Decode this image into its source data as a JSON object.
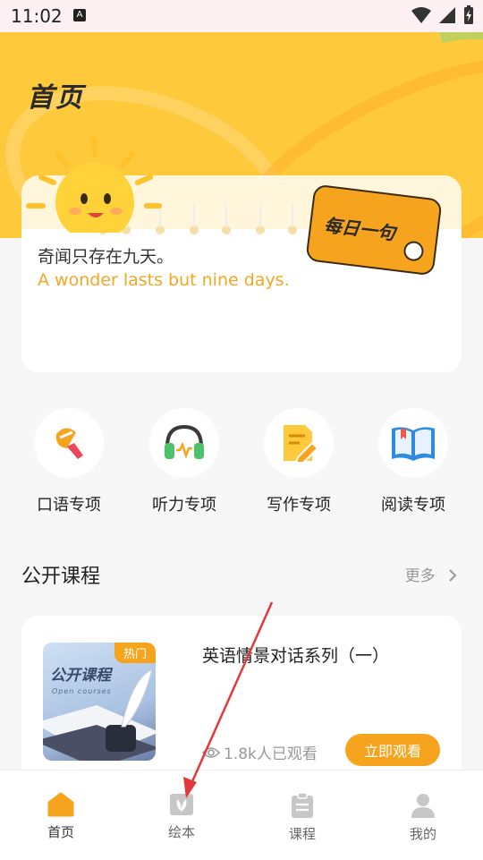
{
  "status_bar": {
    "time": "11:02",
    "keyboard_badge": "A"
  },
  "header": {
    "title": "首页"
  },
  "daily_quote": {
    "tag": "每日一句",
    "chinese": "奇闻只存在九天。",
    "english": "A wonder lasts but nine days."
  },
  "features": [
    {
      "label": "口语专项",
      "icon": "megaphone-icon"
    },
    {
      "label": "听力专项",
      "icon": "headphones-icon"
    },
    {
      "label": "写作专项",
      "icon": "writing-pad-icon"
    },
    {
      "label": "阅读专项",
      "icon": "open-book-icon"
    }
  ],
  "public_courses": {
    "title": "公开课程",
    "more": "更多",
    "course": {
      "badge": "热门",
      "thumb_title": "公开课程",
      "thumb_subtitle": "Open courses",
      "title": "英语情景对话系列（一）",
      "views": "1.8k人已观看",
      "button": "立即观看"
    }
  },
  "tabbar": [
    {
      "label": "首页",
      "icon": "home-icon",
      "active": true
    },
    {
      "label": "绘本",
      "icon": "picture-book-icon",
      "active": false
    },
    {
      "label": "课程",
      "icon": "clipboard-icon",
      "active": false
    },
    {
      "label": "我的",
      "icon": "person-icon",
      "active": false
    }
  ],
  "colors": {
    "accent": "#f6a41e",
    "hero": "#ffc93c",
    "annotation_arrow": "#e03a3a"
  }
}
